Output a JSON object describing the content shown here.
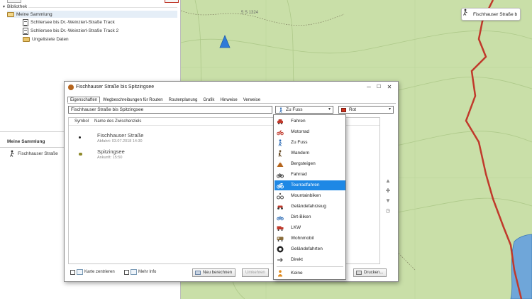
{
  "library": {
    "header": "Bibliothek",
    "tree": [
      {
        "label": "Meine Sammlung",
        "icon": "folder-open-icon"
      },
      {
        "label": "Schliersee bis Dr.-Weinzierl-Straße Track",
        "icon": "document-icon"
      },
      {
        "label": "Schliersee bis Dr.-Weinzierl-Straße Track 2",
        "icon": "document-icon"
      },
      {
        "label": "Ungelistete Daten",
        "icon": "folder-icon"
      }
    ],
    "collection_title": "Meine Sammlung",
    "collection_item": "Fischhauser Straße"
  },
  "map": {
    "place_label": "5 S 1324",
    "callout": "Fischhauser Straße b",
    "colors": {
      "terrain": "#c9dfa8",
      "route": "#c0392b",
      "water": "#3a8fd8"
    }
  },
  "dialog": {
    "title": "Fischhauser Straße bis Spitzingsee",
    "minimize": "─",
    "maximize": "☐",
    "close": "✕",
    "tabs": [
      "Eigenschaften",
      "Wegbeschreibungen für Routen",
      "Routenplanung",
      "Grafik",
      "Hinweise",
      "Verweise"
    ],
    "name_value": "Fischhauser Straße bis Spitzingsee",
    "mode_value": "Zu Fuss",
    "color_value": "Rot",
    "list_headers": {
      "symbol": "Symbol",
      "name": "Name des Zwischenziels"
    },
    "waypoints": [
      {
        "name": "Fischhauser Straße",
        "detail": "Abfahrt: 03.07.2018 14:30"
      },
      {
        "name": "Spitzingsee",
        "detail": "Ankunft: 15:50"
      }
    ],
    "side_buttons": [
      "▲",
      "✚",
      "▼",
      "◷"
    ],
    "checkbox_route": "Karte zentrieren",
    "checkbox_info": "Mehr Info",
    "btn_recalc": "Neu berechnen",
    "btn_invert": "Umkehren",
    "btn_print": "Drucken..."
  },
  "dropdown": {
    "selected": "Tourradfahren",
    "items": [
      {
        "label": "Fahren",
        "icon": "car-icon"
      },
      {
        "label": "Motorrad",
        "icon": "motorcycle-icon"
      },
      {
        "label": "Zu Fuss",
        "icon": "walker-icon"
      },
      {
        "label": "Wandern",
        "icon": "hiker-icon"
      },
      {
        "label": "Bergsteigen",
        "icon": "mountain-icon"
      },
      {
        "label": "Fahrrad",
        "icon": "bicycle-icon"
      },
      {
        "label": "Tourradfahren",
        "icon": "touring-bike-icon"
      },
      {
        "label": "Mountainbiken",
        "icon": "mountain-bike-icon"
      },
      {
        "label": "Geländefahrzeug",
        "icon": "atv-icon"
      },
      {
        "label": "Dirt-Biken",
        "icon": "dirt-bike-icon"
      },
      {
        "label": "LKW",
        "icon": "truck-icon"
      },
      {
        "label": "Wohnmobil",
        "icon": "rv-icon"
      },
      {
        "label": "Geländefahrten",
        "icon": "offroad-icon"
      },
      {
        "label": "Direkt",
        "icon": "direct-icon"
      },
      {
        "label": "Keine",
        "icon": "none-icon"
      }
    ]
  }
}
